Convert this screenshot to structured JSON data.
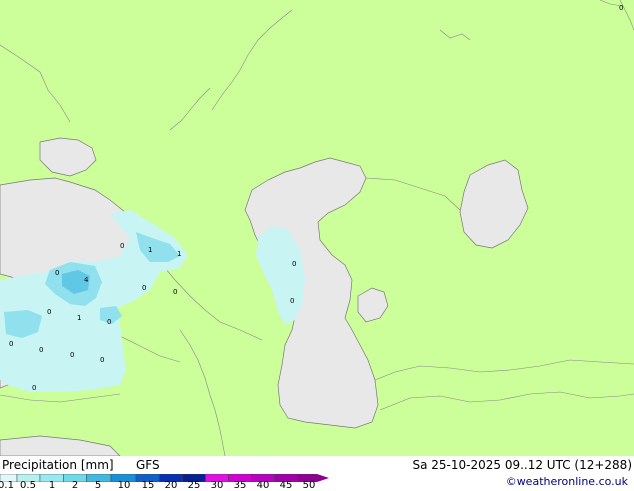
{
  "footer": {
    "title": "Precipitation [mm]",
    "model": "GFS",
    "datetime": "Sa 25-10-2025 09..12 UTC (12+288)",
    "credit": "©weatheronline.co.uk"
  },
  "legend": {
    "values": [
      "0.1",
      "0.5",
      "1",
      "2",
      "5",
      "10",
      "15",
      "20",
      "25",
      "30",
      "35",
      "40",
      "45",
      "50"
    ],
    "colors": [
      "#e0f8f8",
      "#b8f0f0",
      "#98e8f0",
      "#70d8e8",
      "#40b8e0",
      "#1890d8",
      "#1060c8",
      "#0830b0",
      "#082090",
      "#e010e0",
      "#d000d0",
      "#b800c0",
      "#a000a8",
      "#900090"
    ]
  },
  "map": {
    "land_color": "#ccff99",
    "water_color": "#e8e8e8",
    "precip_light_color": "#c8f4f4",
    "precip_med_color": "#90e0ee",
    "precip_heavy_color": "#60c8e4",
    "point_values": [
      "0",
      "1",
      "1",
      "0",
      "4",
      "0",
      "0",
      "1",
      "0",
      "0",
      "0",
      "0",
      "0",
      "0",
      "0",
      "0",
      "0",
      "0"
    ]
  }
}
